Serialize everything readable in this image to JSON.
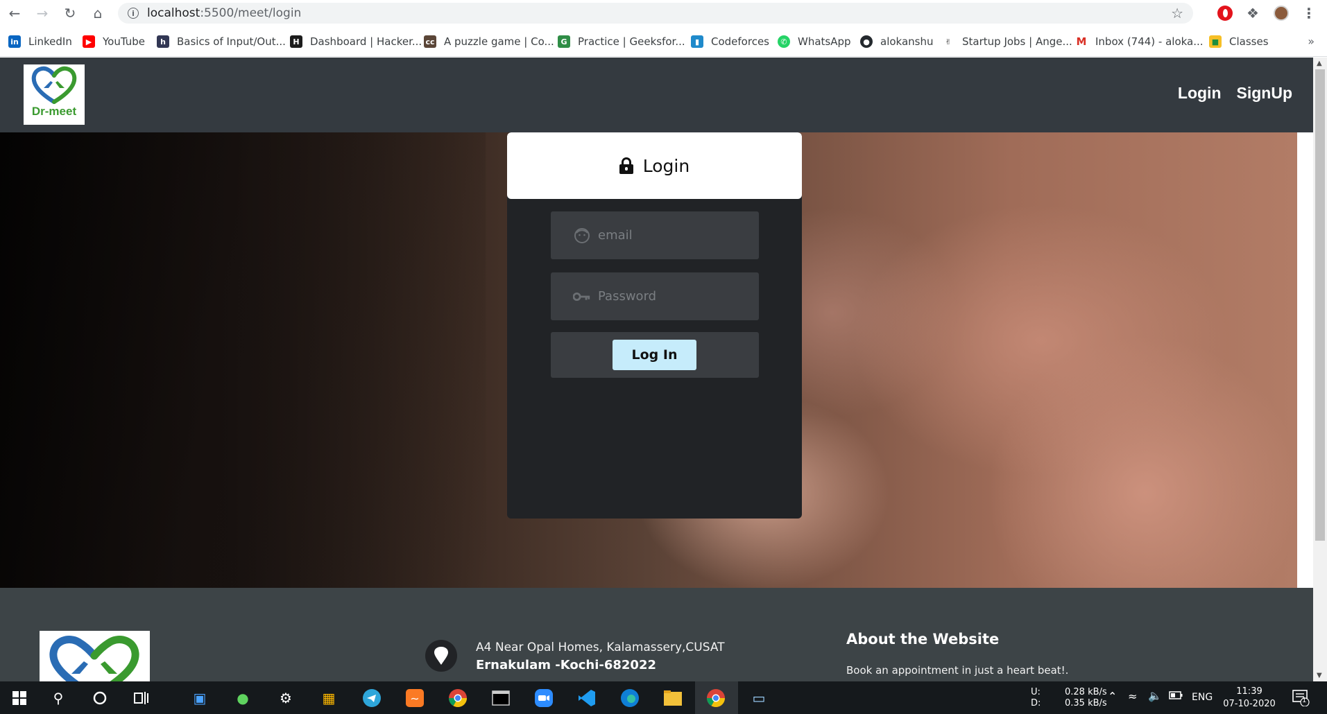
{
  "browser": {
    "url_host": "localhost",
    "url_path": ":5500/meet/login",
    "bookmarks": [
      {
        "label": "LinkedIn",
        "icon": "linkedin-icon",
        "color": "#0a66c2"
      },
      {
        "label": "YouTube",
        "icon": "youtube-icon",
        "color": "#ff0000"
      },
      {
        "label": "Basics of Input/Out...",
        "icon": "hackerearth-icon",
        "color": "#323754"
      },
      {
        "label": "Dashboard | Hacker...",
        "icon": "hackerrank-icon",
        "color": "#1c1c1c"
      },
      {
        "label": "A puzzle game | Co...",
        "icon": "codechef-icon",
        "color": "#5b4638"
      },
      {
        "label": "Practice | Geeksfor...",
        "icon": "geeksforgeeks-icon",
        "color": "#2f8d46"
      },
      {
        "label": "Codeforces",
        "icon": "codeforces-icon",
        "color": "#1f8acb"
      },
      {
        "label": "WhatsApp",
        "icon": "whatsapp-icon",
        "color": "#25d366"
      },
      {
        "label": "alokanshu",
        "icon": "github-icon",
        "color": "#24292e"
      },
      {
        "label": "Startup Jobs | Ange...",
        "icon": "angellist-icon",
        "color": "#333333"
      },
      {
        "label": "Inbox (744) - aloka...",
        "icon": "gmail-icon",
        "color": "#d93025"
      },
      {
        "label": "Classes",
        "icon": "classroom-icon",
        "color": "#f6bf26"
      }
    ],
    "bookmarks_more": "»"
  },
  "site": {
    "logo_text": "Dr-meet",
    "nav": {
      "login": "Login",
      "signup": "SignUp"
    }
  },
  "login": {
    "title": "Login",
    "email_placeholder": "email",
    "password_placeholder": "Password",
    "submit_label": "Log In"
  },
  "footer": {
    "address_line1": "A4 Near Opal Homes, Kalamassery,CUSAT",
    "address_line2": "Ernakulam -Kochi-682022",
    "about_title": "About the Website",
    "about_text": "Book an appointment in just a heart beat!."
  },
  "taskbar": {
    "net_up_label": "U:",
    "net_down_label": "D:",
    "net_up": "0.28 kB/s",
    "net_down": "0.35 kB/s",
    "language": "ENG",
    "time": "11:39",
    "date": "07-10-2020",
    "notification_count": "1"
  },
  "colors": {
    "navbar": "#343a40",
    "card": "#212326",
    "field": "#3a3d41",
    "button": "#c6ecfb",
    "footer": "#3d4447",
    "logo_green": "#3a9a2f",
    "logo_blue": "#2a6cb4"
  }
}
